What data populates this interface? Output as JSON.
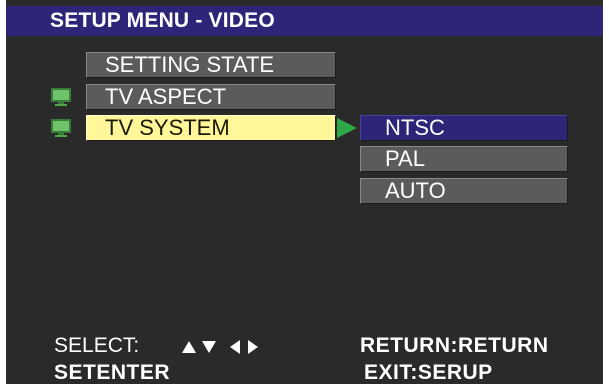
{
  "title": "SETUP MENU - VIDEO",
  "menu": {
    "items": [
      {
        "label": "SETTING STATE"
      },
      {
        "label": "TV ASPECT"
      },
      {
        "label": "TV SYSTEM"
      }
    ]
  },
  "submenu": {
    "options": [
      {
        "label": "NTSC",
        "selected": true
      },
      {
        "label": "PAL",
        "selected": false
      },
      {
        "label": "AUTO",
        "selected": false
      }
    ]
  },
  "footer": {
    "select_label": "SELECT:",
    "enter_label": "SETENTER",
    "return_label": "RETURN:RETURN",
    "exit_label": "EXIT:SERUP"
  },
  "colors": {
    "background": "#2a2a2a",
    "title_bar": "#2c2578",
    "menu_item": "#5b5b5b",
    "menu_item_active": "#fff799",
    "option_selected": "#2c2578",
    "arrow": "#2fa84a",
    "tv_icon": "#4fa84a"
  },
  "icons": [
    "tv-icon",
    "right-arrow-icon",
    "up-arrow-icon",
    "down-arrow-icon",
    "left-arrow-icon"
  ]
}
